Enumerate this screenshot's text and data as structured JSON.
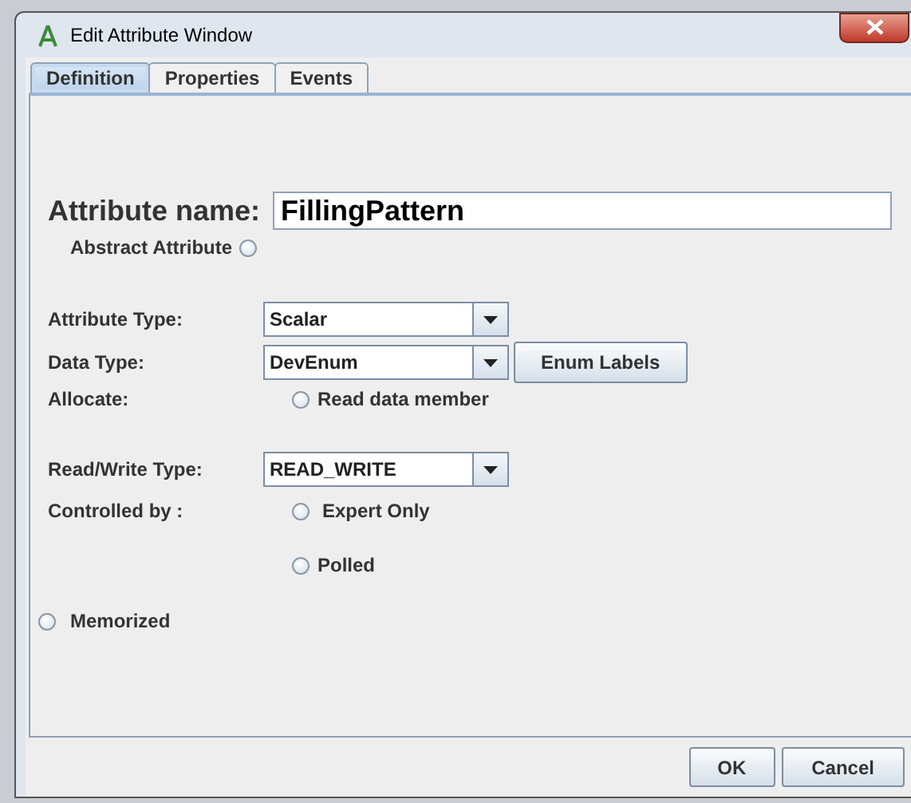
{
  "window": {
    "title": "Edit Attribute Window"
  },
  "tabs": [
    {
      "label": "Definition",
      "selected": true
    },
    {
      "label": "Properties",
      "selected": false
    },
    {
      "label": "Events",
      "selected": false
    }
  ],
  "attribute_name": {
    "label": "Attribute name:",
    "value": "FillingPattern"
  },
  "abstract_attribute": {
    "label": "Abstract Attribute",
    "checked": false
  },
  "attribute_type": {
    "label": "Attribute Type:",
    "value": "Scalar"
  },
  "data_type": {
    "label": "Data Type:",
    "value": "DevEnum",
    "button": "Enum Labels"
  },
  "allocate": {
    "label": "Allocate:",
    "option": {
      "label": "Read data member",
      "checked": false
    }
  },
  "read_write_type": {
    "label": "Read/Write Type:",
    "value": "READ_WRITE"
  },
  "controlled_by": {
    "label": "Controlled by :",
    "options": [
      {
        "label": "Expert Only",
        "checked": false
      },
      {
        "label": "Polled",
        "checked": false
      }
    ]
  },
  "memorized": {
    "label": "Memorized",
    "checked": false
  },
  "buttons": [
    "OK",
    "Cancel"
  ]
}
